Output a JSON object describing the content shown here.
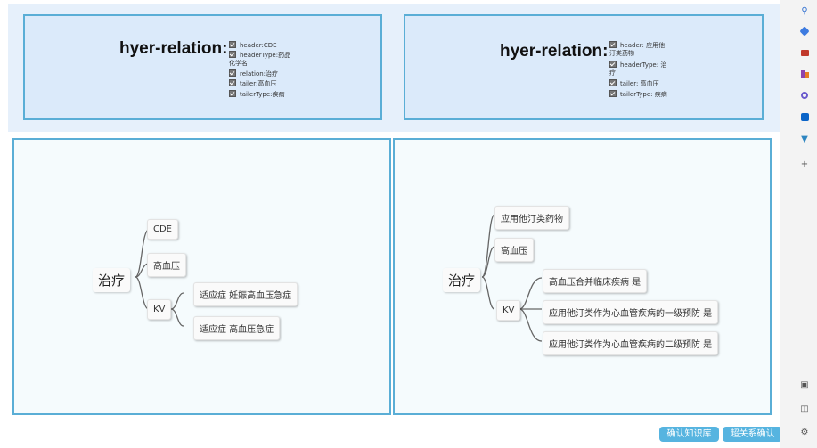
{
  "left_header": {
    "title": "hyer-relation:",
    "items": [
      "header:CDE",
      "headerType:药品\n化学名",
      "relation:治疗",
      "tailer:高血压",
      "tailerType:疾病"
    ]
  },
  "right_header": {
    "title": "hyer-relation:",
    "items": [
      "header: 应用他\n汀类药物",
      "headerType: 治\n疗",
      "tailer: 高血压",
      "tailerType: 疾病"
    ]
  },
  "left_map": {
    "root": "治疗",
    "children": [
      "CDE",
      "高血压",
      "KV"
    ],
    "kv_children": [
      "适应症 妊娠高血压急症",
      "适应症 高血压急症"
    ]
  },
  "right_map": {
    "root": "治疗",
    "children": [
      "应用他汀类药物",
      "高血压",
      "KV"
    ],
    "kv_children": [
      "高血压合并临床疾病 是",
      "应用他汀类作为心血管疾病的一级预防 是",
      "应用他汀类作为心血管疾病的二级预防 是"
    ]
  },
  "buttons": {
    "confirm_kb": "确认知识库",
    "confirm_relation": "超关系确认"
  },
  "sidebar_icons": [
    "search-icon",
    "tag-icon",
    "briefcase-icon",
    "people-icon",
    "settings-icon",
    "outlook-icon",
    "cart-icon",
    "plus-icon",
    "screenshot-icon",
    "panel-icon",
    "gear-icon"
  ],
  "colors": {
    "panel_border": "#5aaed6",
    "button": "#56b4e0",
    "header_bg": "#dbeafa"
  }
}
